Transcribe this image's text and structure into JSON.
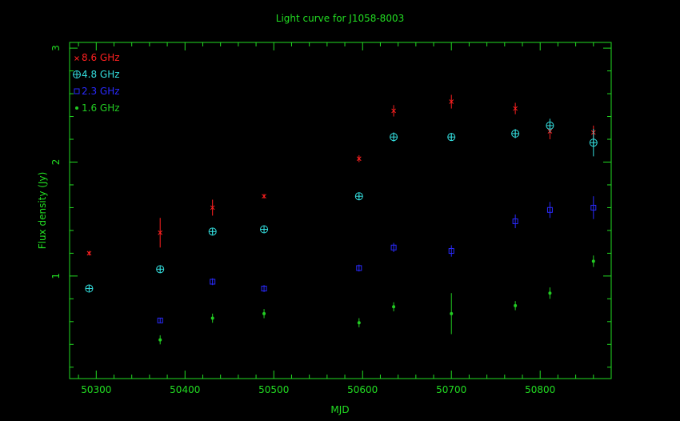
{
  "colors": {
    "frame": "#22dd22",
    "title": "#22dd22",
    "s86": "#ff2020",
    "s48": "#33dddd",
    "s23": "#2a2aff",
    "s16": "#22cc22"
  },
  "chart_data": {
    "type": "scatter",
    "title": "Light curve for J1058-8003",
    "xlabel": "MJD",
    "ylabel": "Flux density (Jy)",
    "xlim": [
      50270,
      50880
    ],
    "ylim": [
      0.1,
      3.05
    ],
    "xticks": [
      50300,
      50400,
      50500,
      50600,
      50700,
      50800
    ],
    "yticks": [
      1,
      2,
      3
    ],
    "legend_position": "top-left",
    "series": [
      {
        "name": "8.6 GHz",
        "marker": "x",
        "colorKey": "s86",
        "points": [
          {
            "x": 50292,
            "y": 1.2,
            "err": 0.02
          },
          {
            "x": 50372,
            "y": 1.38,
            "err": 0.13
          },
          {
            "x": 50431,
            "y": 1.6,
            "err": 0.07
          },
          {
            "x": 50489,
            "y": 1.7,
            "err": 0.02
          },
          {
            "x": 50596,
            "y": 2.03,
            "err": 0.03
          },
          {
            "x": 50635,
            "y": 2.45,
            "err": 0.05
          },
          {
            "x": 50700,
            "y": 2.53,
            "err": 0.06
          },
          {
            "x": 50772,
            "y": 2.47,
            "err": 0.05
          },
          {
            "x": 50811,
            "y": 2.27,
            "err": 0.07
          },
          {
            "x": 50860,
            "y": 2.26,
            "err": 0.06
          }
        ]
      },
      {
        "name": "4.8 GHz",
        "marker": "circle-plus",
        "colorKey": "s48",
        "points": [
          {
            "x": 50292,
            "y": 0.89,
            "err": 0.02
          },
          {
            "x": 50372,
            "y": 1.06,
            "err": 0.02
          },
          {
            "x": 50431,
            "y": 1.39,
            "err": 0.02
          },
          {
            "x": 50489,
            "y": 1.41,
            "err": 0.02
          },
          {
            "x": 50596,
            "y": 1.7,
            "err": 0.02
          },
          {
            "x": 50635,
            "y": 2.22,
            "err": 0.04
          },
          {
            "x": 50700,
            "y": 2.22,
            "err": 0.03
          },
          {
            "x": 50772,
            "y": 2.25,
            "err": 0.04
          },
          {
            "x": 50811,
            "y": 2.32,
            "err": 0.06
          },
          {
            "x": 50860,
            "y": 2.17,
            "err": 0.12
          }
        ]
      },
      {
        "name": "2.3 GHz",
        "marker": "square",
        "colorKey": "s23",
        "points": [
          {
            "x": 50372,
            "y": 0.61,
            "err": 0.02
          },
          {
            "x": 50431,
            "y": 0.95,
            "err": 0.03
          },
          {
            "x": 50489,
            "y": 0.89,
            "err": 0.03
          },
          {
            "x": 50596,
            "y": 1.07,
            "err": 0.03
          },
          {
            "x": 50635,
            "y": 1.25,
            "err": 0.04
          },
          {
            "x": 50700,
            "y": 1.22,
            "err": 0.05
          },
          {
            "x": 50772,
            "y": 1.48,
            "err": 0.06
          },
          {
            "x": 50811,
            "y": 1.58,
            "err": 0.07
          },
          {
            "x": 50860,
            "y": 1.6,
            "err": 0.1
          }
        ]
      },
      {
        "name": "1.6 GHz",
        "marker": "dot",
        "colorKey": "s16",
        "points": [
          {
            "x": 50372,
            "y": 0.44,
            "err": 0.04
          },
          {
            "x": 50431,
            "y": 0.63,
            "err": 0.04
          },
          {
            "x": 50489,
            "y": 0.67,
            "err": 0.04
          },
          {
            "x": 50596,
            "y": 0.59,
            "err": 0.04
          },
          {
            "x": 50635,
            "y": 0.73,
            "err": 0.04
          },
          {
            "x": 50700,
            "y": 0.67,
            "err": 0.18
          },
          {
            "x": 50772,
            "y": 0.74,
            "err": 0.04
          },
          {
            "x": 50811,
            "y": 0.85,
            "err": 0.05
          },
          {
            "x": 50860,
            "y": 1.13,
            "err": 0.05
          }
        ]
      }
    ]
  }
}
